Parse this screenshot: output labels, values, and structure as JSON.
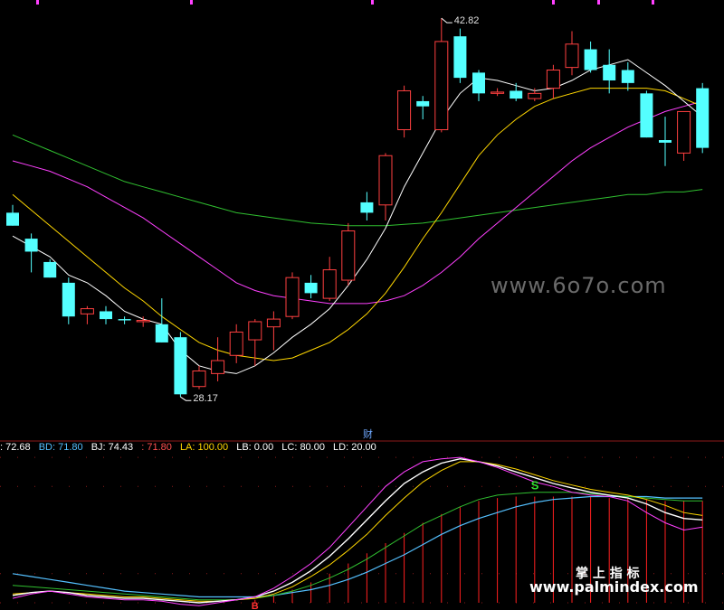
{
  "chart_data": [
    {
      "type": "candlestick",
      "colors": {
        "up": "#ff4040",
        "down": "#54ffff",
        "ma5": "#ffffff",
        "ma10": "#ffd700",
        "ma20": "#ff40ff",
        "ma60": "#30c030"
      },
      "ylim": [
        26.5,
        43.5
      ],
      "annotations": {
        "high": "42.82",
        "low": "28.17",
        "marker": "财"
      },
      "candles": [
        {
          "o": 35.3,
          "h": 35.6,
          "l": 34.8,
          "c": 34.8
        },
        {
          "o": 34.3,
          "h": 34.5,
          "l": 33.0,
          "c": 33.8
        },
        {
          "o": 33.4,
          "h": 33.5,
          "l": 32.8,
          "c": 32.8
        },
        {
          "o": 32.6,
          "h": 32.8,
          "l": 31.0,
          "c": 31.3
        },
        {
          "o": 31.4,
          "h": 31.7,
          "l": 31.0,
          "c": 31.6
        },
        {
          "o": 31.5,
          "h": 31.7,
          "l": 31.0,
          "c": 31.2
        },
        {
          "o": 31.2,
          "h": 31.3,
          "l": 31.0,
          "c": 31.15
        },
        {
          "o": 31.1,
          "h": 31.3,
          "l": 30.9,
          "c": 31.15
        },
        {
          "o": 31.0,
          "h": 32.0,
          "l": 30.3,
          "c": 30.3
        },
        {
          "o": 30.5,
          "h": 30.7,
          "l": 28.2,
          "c": 28.3
        },
        {
          "o": 28.6,
          "h": 29.4,
          "l": 28.5,
          "c": 29.2
        },
        {
          "o": 29.1,
          "h": 30.5,
          "l": 28.8,
          "c": 29.6
        },
        {
          "o": 29.8,
          "h": 31.0,
          "l": 29.5,
          "c": 30.7
        },
        {
          "o": 30.4,
          "h": 31.2,
          "l": 29.4,
          "c": 31.1
        },
        {
          "o": 30.9,
          "h": 31.5,
          "l": 30.0,
          "c": 31.2
        },
        {
          "o": 31.3,
          "h": 33.0,
          "l": 31.2,
          "c": 32.8
        },
        {
          "o": 32.6,
          "h": 32.9,
          "l": 32.0,
          "c": 32.2
        },
        {
          "o": 32.0,
          "h": 33.6,
          "l": 31.9,
          "c": 33.1
        },
        {
          "o": 32.7,
          "h": 34.9,
          "l": 32.5,
          "c": 34.6
        },
        {
          "o": 35.7,
          "h": 36.1,
          "l": 35.0,
          "c": 35.3
        },
        {
          "o": 35.6,
          "h": 37.6,
          "l": 35.0,
          "c": 37.5
        },
        {
          "o": 38.5,
          "h": 40.2,
          "l": 38.2,
          "c": 40.0
        },
        {
          "o": 39.6,
          "h": 39.8,
          "l": 38.9,
          "c": 39.4
        },
        {
          "o": 38.5,
          "h": 42.8,
          "l": 38.4,
          "c": 41.9
        },
        {
          "o": 42.1,
          "h": 42.4,
          "l": 40.3,
          "c": 40.5
        },
        {
          "o": 40.7,
          "h": 40.8,
          "l": 39.6,
          "c": 39.9
        },
        {
          "o": 39.9,
          "h": 40.1,
          "l": 39.8,
          "c": 39.95
        },
        {
          "o": 40.0,
          "h": 40.3,
          "l": 39.6,
          "c": 39.7
        },
        {
          "o": 39.7,
          "h": 40.1,
          "l": 39.6,
          "c": 39.9
        },
        {
          "o": 40.1,
          "h": 41.0,
          "l": 39.7,
          "c": 40.8
        },
        {
          "o": 40.9,
          "h": 42.3,
          "l": 40.6,
          "c": 41.8
        },
        {
          "o": 41.6,
          "h": 41.9,
          "l": 40.7,
          "c": 40.8
        },
        {
          "o": 41.0,
          "h": 41.6,
          "l": 39.9,
          "c": 40.4
        },
        {
          "o": 40.8,
          "h": 41.1,
          "l": 40.0,
          "c": 40.3
        },
        {
          "o": 39.9,
          "h": 40.0,
          "l": 38.2,
          "c": 38.2
        },
        {
          "o": 38.1,
          "h": 39.0,
          "l": 37.1,
          "c": 38.0
        },
        {
          "o": 37.6,
          "h": 39.0,
          "l": 37.3,
          "c": 39.2
        },
        {
          "o": 40.1,
          "h": 40.3,
          "l": 37.6,
          "c": 37.8
        }
      ],
      "ma5": [
        34.4,
        34.0,
        33.6,
        32.9,
        32.6,
        32.1,
        31.5,
        31.2,
        31.0,
        30.0,
        29.4,
        29.2,
        29.1,
        29.4,
        29.9,
        30.5,
        31.0,
        31.6,
        32.5,
        33.5,
        34.7,
        36.3,
        37.6,
        38.9,
        39.9,
        40.5,
        40.4,
        40.2,
        40.0,
        40.1,
        40.4,
        40.8,
        41.0,
        41.2,
        40.7,
        40.2,
        39.6,
        39.0
      ],
      "ma10": [
        36.0,
        35.4,
        34.8,
        34.2,
        33.6,
        33.0,
        32.4,
        31.9,
        31.3,
        30.8,
        30.3,
        30.0,
        29.8,
        29.7,
        29.6,
        29.7,
        30.0,
        30.3,
        30.8,
        31.4,
        32.2,
        33.2,
        34.3,
        35.3,
        36.4,
        37.5,
        38.3,
        38.9,
        39.4,
        39.7,
        39.9,
        40.1,
        40.1,
        40.1,
        40.1,
        40.0,
        39.7,
        39.4
      ],
      "ma20": [
        37.3,
        37.1,
        36.9,
        36.6,
        36.3,
        35.9,
        35.5,
        35.1,
        34.6,
        34.1,
        33.6,
        33.1,
        32.6,
        32.3,
        32.1,
        32.0,
        31.9,
        31.8,
        31.8,
        31.8,
        31.9,
        32.1,
        32.5,
        33.0,
        33.6,
        34.3,
        34.9,
        35.5,
        36.1,
        36.7,
        37.3,
        37.8,
        38.2,
        38.6,
        38.9,
        39.2,
        39.4,
        39.6
      ],
      "ma60": [
        38.3,
        38.0,
        37.7,
        37.4,
        37.1,
        36.8,
        36.5,
        36.3,
        36.1,
        35.9,
        35.7,
        35.5,
        35.3,
        35.2,
        35.1,
        35.0,
        34.9,
        34.85,
        34.8,
        34.8,
        34.8,
        34.85,
        34.9,
        35.0,
        35.1,
        35.2,
        35.3,
        35.4,
        35.5,
        35.6,
        35.7,
        35.8,
        35.9,
        36.0,
        36.0,
        36.1,
        36.1,
        36.2
      ]
    },
    {
      "type": "line",
      "legend": [
        {
          "text": ": 72.68",
          "color": "#ffffff"
        },
        {
          "text": "BD: 71.80",
          "color": "#54c0ff"
        },
        {
          "text": "BJ: 74.43",
          "color": "#ffffff"
        },
        {
          "text": ": 71.80",
          "color": "#ff5050"
        },
        {
          "text": "LA: 100.00",
          "color": "#ffd700"
        },
        {
          "text": "LB: 0.00",
          "color": "#ffffff"
        },
        {
          "text": "LC: 80.00",
          "color": "#ffffff"
        },
        {
          "text": "LD: 20.00",
          "color": "#ffffff"
        }
      ],
      "ylim": [
        -5,
        110
      ],
      "levels": [
        100,
        80,
        20,
        0
      ],
      "marker_s": "S",
      "marker_b": "B",
      "colors": {
        "magenta": "#ff40ff",
        "white": "#ffffff",
        "yellow": "#ffd700",
        "green": "#30c030",
        "cyan": "#54c0ff",
        "bars": "#ff2020"
      },
      "magenta": [
        3,
        6,
        8,
        6,
        4,
        3,
        2,
        2,
        1,
        -1,
        -2,
        0,
        2,
        4,
        10,
        18,
        27,
        38,
        52,
        66,
        80,
        90,
        97,
        99,
        100,
        97,
        93,
        88,
        83,
        80,
        76,
        74,
        73,
        70,
        62,
        55,
        50,
        52
      ],
      "white": [
        5,
        7,
        8,
        7,
        5,
        4,
        3,
        3,
        2,
        1,
        0,
        1,
        2,
        4,
        8,
        14,
        22,
        32,
        44,
        57,
        70,
        82,
        90,
        96,
        99,
        97,
        94,
        90,
        86,
        82,
        79,
        76,
        74,
        72,
        68,
        62,
        58,
        57
      ],
      "yellow": [
        6,
        7,
        8,
        7,
        6,
        5,
        4,
        4,
        3,
        2,
        1,
        1,
        2,
        3,
        6,
        11,
        18,
        26,
        36,
        47,
        60,
        72,
        83,
        91,
        97,
        97,
        95,
        92,
        88,
        84,
        81,
        78,
        76,
        74,
        71,
        67,
        62,
        60
      ],
      "green": [
        12,
        11,
        10,
        9,
        8,
        7,
        6,
        5,
        4,
        3,
        2,
        2,
        2,
        3,
        5,
        8,
        12,
        17,
        23,
        30,
        38,
        46,
        54,
        60,
        66,
        71,
        74,
        75,
        76,
        76,
        76,
        75,
        74,
        73,
        72,
        71,
        70,
        70
      ],
      "cyan": [
        20,
        18,
        16,
        14,
        12,
        10,
        8,
        7,
        6,
        5,
        4,
        4,
        4,
        4,
        5,
        7,
        9,
        12,
        16,
        21,
        27,
        33,
        40,
        47,
        53,
        58,
        62,
        66,
        69,
        71,
        72,
        73,
        73,
        73,
        73,
        72,
        72,
        72
      ],
      "bars": [
        0,
        0,
        0,
        0,
        0,
        0,
        0,
        0,
        0,
        0,
        0,
        0,
        0,
        2,
        5,
        9,
        14,
        20,
        27,
        34,
        41,
        48,
        55,
        61,
        66,
        70,
        72,
        73,
        73,
        73,
        73,
        73,
        72,
        72,
        71,
        70,
        70,
        70
      ]
    }
  ],
  "watermarks": {
    "top_right": "www.6o7o.com",
    "bottom_cn": "掌 上 指 标",
    "bottom_url": "www.palmindex.com"
  }
}
